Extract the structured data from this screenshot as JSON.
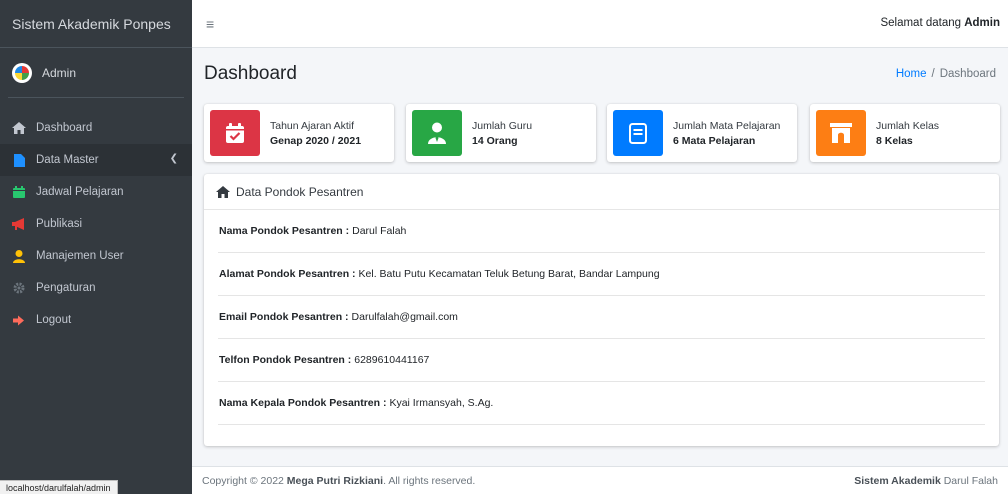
{
  "sidebar": {
    "brand": "Sistem Akademik Ponpes",
    "user": "Admin",
    "items": [
      {
        "label": "Dashboard"
      },
      {
        "label": "Data Master"
      },
      {
        "label": "Jadwal Pelajaran"
      },
      {
        "label": "Publikasi"
      },
      {
        "label": "Manajemen User"
      },
      {
        "label": "Pengaturan"
      },
      {
        "label": "Logout"
      }
    ]
  },
  "topbar": {
    "welcome_prefix": "Selamat datang ",
    "welcome_user": "Admin"
  },
  "header": {
    "title": "Dashboard",
    "breadcrumb_home": "Home",
    "breadcrumb_sep": "/",
    "breadcrumb_current": "Dashboard"
  },
  "cards": [
    {
      "label": "Tahun Ajaran Aktif",
      "value": "Genap 2020 / 2021",
      "color": "#dc3545",
      "icon": "calendar-check-icon"
    },
    {
      "label": "Jumlah Guru",
      "value": "14 Orang",
      "color": "#28a745",
      "icon": "teacher-icon"
    },
    {
      "label": "Jumlah Mata Pelajaran",
      "value": "6 Mata Pelajaran",
      "color": "#007bff",
      "icon": "book-icon"
    },
    {
      "label": "Jumlah Kelas",
      "value": "8 Kelas",
      "color": "#fd7e14",
      "icon": "archway-icon"
    }
  ],
  "panel": {
    "title": "Data Pondok Pesantren",
    "rows": [
      {
        "label": "Nama Pondok Pesantren :",
        "value": "Darul Falah"
      },
      {
        "label": "Alamat Pondok Pesantren :",
        "value": "Kel. Batu Putu Kecamatan Teluk Betung Barat, Bandar Lampung"
      },
      {
        "label": "Email Pondok Pesantren :",
        "value": "Darulfalah@gmail.com"
      },
      {
        "label": "Telfon Pondok Pesantren :",
        "value": "6289610441167"
      },
      {
        "label": "Nama Kepala Pondok Pesantren :",
        "value": "Kyai Irmansyah, S.Ag."
      }
    ]
  },
  "footer": {
    "copyright_prefix": "Copyright © 2022 ",
    "copyright_name": "Mega Putri Rizkiani",
    "copyright_suffix": ". All rights reserved.",
    "right_bold": "Sistem Akademik",
    "right_text": " Darul Falah"
  },
  "status_url": "localhost/darulfalah/admin"
}
